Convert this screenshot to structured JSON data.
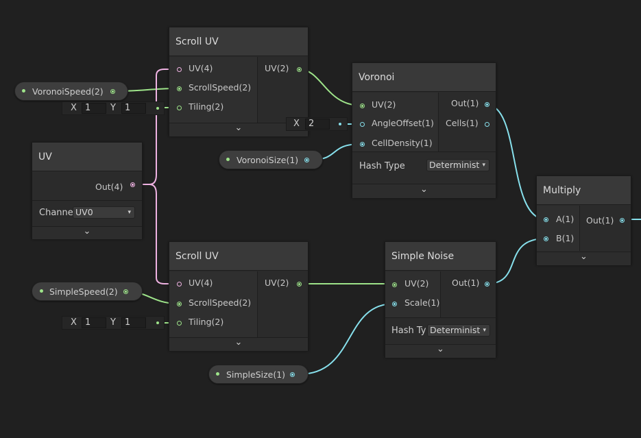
{
  "icons": {
    "collapse": "chevron-down-icon",
    "dropdown": "triangle-down-icon"
  },
  "colors": {
    "vector2": "#9ee48a",
    "vector4": "#f0b3e3",
    "float": "#87e0ec",
    "background": "#202020"
  },
  "nodes": {
    "scroll_uv_top": {
      "title": "Scroll UV",
      "in": [
        "UV(4)",
        "ScrollSpeed(2)",
        "Tiling(2)"
      ],
      "out": [
        "UV(2)"
      ]
    },
    "voronoi": {
      "title": "Voronoi",
      "in": [
        "UV(2)",
        "AngleOffset(1)",
        "CellDensity(1)"
      ],
      "out": [
        "Out(1)",
        "Cells(1)"
      ],
      "hash_label": "Hash Type",
      "hash_value": "Determinist"
    },
    "uv": {
      "title": "UV",
      "out": [
        "Out(4)"
      ],
      "channel_label": "Channe",
      "channel_value": "UV0"
    },
    "scroll_uv_bottom": {
      "title": "Scroll UV",
      "in": [
        "UV(4)",
        "ScrollSpeed(2)",
        "Tiling(2)"
      ],
      "out": [
        "UV(2)"
      ]
    },
    "simple_noise": {
      "title": "Simple Noise",
      "in": [
        "UV(2)",
        "Scale(1)"
      ],
      "out": [
        "Out(1)"
      ],
      "hash_label": "Hash Ty",
      "hash_value": "Determinist"
    },
    "multiply": {
      "title": "Multiply",
      "in": [
        "A(1)",
        "B(1)"
      ],
      "out": [
        "Out(1)"
      ]
    }
  },
  "properties": {
    "voronoi_speed": "VoronoiSpeed(2)",
    "voronoi_size": "VoronoiSize(1)",
    "simple_speed": "SimpleSpeed(2)",
    "simple_size": "SimpleSize(1)"
  },
  "inline_values": {
    "tiling_top": {
      "x_label": "X",
      "x": "1",
      "y_label": "Y",
      "y": "1"
    },
    "tiling_bottom": {
      "x_label": "X",
      "x": "1",
      "y_label": "Y",
      "y": "1"
    },
    "angle_offset": {
      "x_label": "X",
      "x": "2"
    }
  },
  "footer_glyph": "⌄",
  "dropdown_glyph": "▾"
}
